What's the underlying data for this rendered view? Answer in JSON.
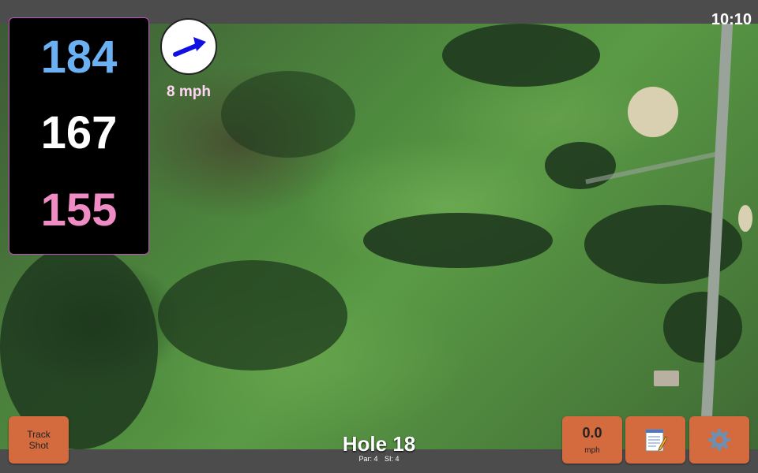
{
  "status": {
    "time": "10:10"
  },
  "distances": {
    "back": "184",
    "middle": "167",
    "front": "155"
  },
  "wind": {
    "speed": "8 mph",
    "icon": "wind-direction-arrow-icon"
  },
  "hole": {
    "title": "Hole 18",
    "par": "Par: 4",
    "si": "SI: 4"
  },
  "buttons": {
    "track_shot": "Track Shot",
    "speed_value": "0.0",
    "speed_unit": "mph",
    "notes_icon": "notepad-icon",
    "settings_icon": "gear-icon"
  },
  "colors": {
    "back": "#6cb0f4",
    "middle": "#ffffff",
    "front": "#f08cc4",
    "button": "#d36b3f",
    "wind_arrow": "#1010e0"
  }
}
